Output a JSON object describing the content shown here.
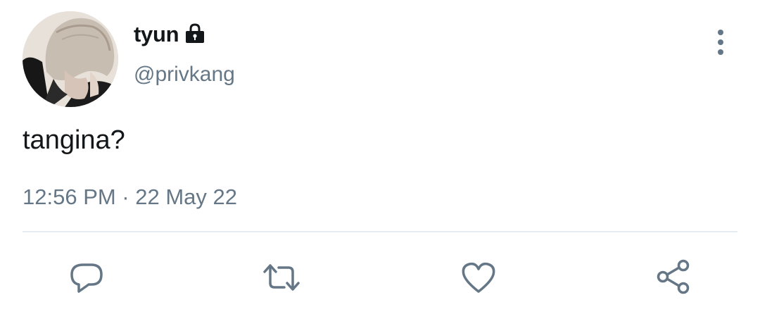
{
  "user": {
    "display_name": "tyun",
    "handle": "@privkang",
    "avatar_icon": "profile-photo",
    "protected_icon": "lock-icon"
  },
  "tweet": {
    "text": "tangina?",
    "timestamp": "12:56 PM · 22 May 22"
  },
  "actions": {
    "reply_icon": "reply-icon",
    "retweet_icon": "retweet-icon",
    "like_icon": "heart-icon",
    "share_icon": "share-icon",
    "more_icon": "more-vertical-icon"
  },
  "colors": {
    "text_primary": "#14171a",
    "text_secondary": "#657786",
    "divider": "#e6ecf0"
  }
}
